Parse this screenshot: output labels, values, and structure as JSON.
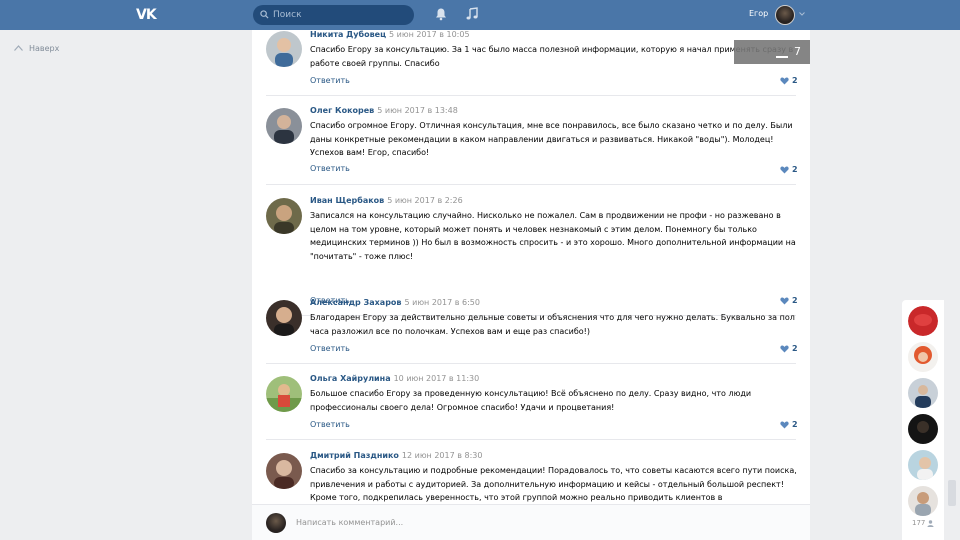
{
  "header": {
    "logo": "VK",
    "search_placeholder": "Поиск",
    "user_name": "Егор"
  },
  "nav": {
    "back_label": "Наверх"
  },
  "counter": {
    "value": "7"
  },
  "comments": [
    {
      "name": "Никита Дубовец",
      "date": "5 июн 2017 в 10:05",
      "text": "Спасибо Егору за консультацию. За 1 час было масса полезной информации, которую я начал применять сразу в работе своей группы. Спасибо",
      "reply": "Ответить",
      "likes": "2"
    },
    {
      "name": "Олег Кокорев",
      "date": "5 июн 2017 в 13:48",
      "text": "Спасибо огромное Егору. Отличная консультация, мне все понравилось, все было сказано четко и по делу. Были даны конкретные рекомендации в каком направлении двигаться и развиваться. Никакой \"воды\"). Молодец! Успехов вам! Егор, спасибо!",
      "reply": "Ответить",
      "likes": "2"
    },
    {
      "name": "Иван Щербаков",
      "date": "5 июн 2017 в 2:26",
      "text": "Записался на консультацию случайно. Нисколько не пожалел. Сам в продвижении не профи - но разжевано в целом на том уровне, который может понять и человек незнакомый с этим делом. Понемногу бы только медицинских терминов )) Но был в возможность спросить - и это хорошо. Много дополнительной информации на \"почитать\" - тоже плюс!",
      "reply": "Ответить",
      "likes": "2"
    },
    {
      "name": "Александр Захаров",
      "date": "5 июн 2017 в 6:50",
      "text": "Благодарен Егору за действительно дельные советы и объяснения что для чего нужно делать. Буквально за пол часа разложил все по полочкам. Успехов вам и еще раз спасибо!)",
      "reply": "Ответить",
      "likes": "2"
    },
    {
      "name": "Ольга Хайрулина",
      "date": "10 июн 2017 в 11:30",
      "text": "Большое спасибо Егору за проведенную консультацию! Всё объяснено по делу. Сразу видно, что люди профессионалы своего дела! Огромное спасибо! Удачи и процветания!",
      "reply": "Ответить",
      "likes": "2"
    },
    {
      "name": "Дмитрий Пазднико",
      "date": "12 июн 2017 в 8:30",
      "text": "Спасибо за консультацию и подробные рекомендации! Порадовалось то, что советы касаются всего пути поиска, привлечения и работы с аудиторией. За дополнительную информацию и кейсы - отдельный большой респект! Кроме того, подкрепилась уверенность, что этой группой можно реально приводить клиентов в",
      "reply": "",
      "likes": ""
    }
  ],
  "compose": {
    "placeholder": "Написать комментарий..."
  },
  "likers": {
    "count": "177"
  },
  "colors": {
    "header": "#4a76a8",
    "link": "#2a5885",
    "background": "#edeef0"
  }
}
